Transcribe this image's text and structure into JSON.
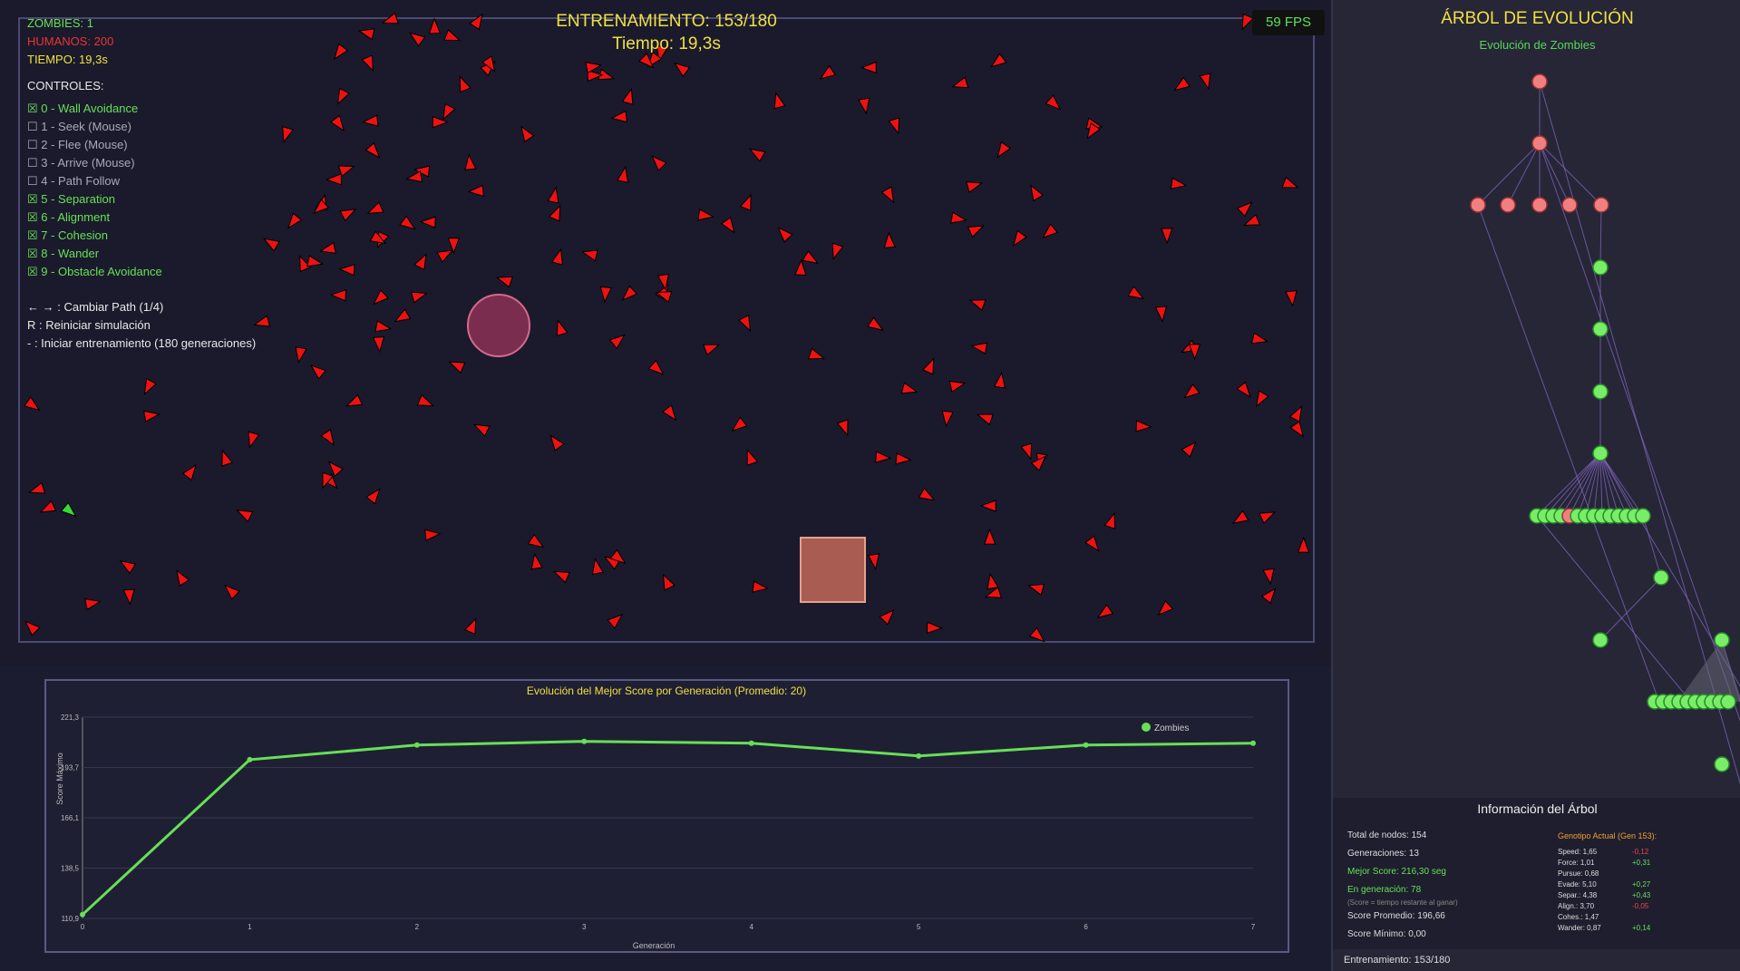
{
  "simulation": {
    "stats": {
      "zombies": "ZOMBIES: 1",
      "humans": "HUMANOS: 200",
      "time": "TIEMPO: 19,3s"
    },
    "controls_header": "CONTROLES:",
    "controls": [
      {
        "label": "☒ 0 - Wall Avoidance",
        "active": true
      },
      {
        "label": "☐ 1 - Seek (Mouse)",
        "active": false
      },
      {
        "label": "☐ 2 - Flee (Mouse)",
        "active": false
      },
      {
        "label": "☐ 3 - Arrive (Mouse)",
        "active": false
      },
      {
        "label": "☐ 4 - Path Follow",
        "active": false
      },
      {
        "label": "☒ 5 - Separation",
        "active": true
      },
      {
        "label": "☒ 6 - Alignment",
        "active": true
      },
      {
        "label": "☒ 7 - Cohesion",
        "active": true
      },
      {
        "label": "☒ 8 - Wander",
        "active": true
      },
      {
        "label": "☒ 9 - Obstacle Avoidance",
        "active": true
      }
    ],
    "hints": [
      "← → : Cambiar Path (1/4)",
      "R : Reiniciar simulación",
      "- : Iniciar entrenamiento (180 generaciones)"
    ],
    "title_line1": "ENTRENAMIENTO: 153/180",
    "title_line2": "Tiempo: 19,3s",
    "fps": "59 FPS",
    "colors": {
      "human": "#ee1111",
      "zombie": "#33dd33",
      "active": "#66e055",
      "humans_text": "#ee3333"
    }
  },
  "chart": {
    "title": "Evolución del Mejor Score por Generación (Promedio: 20)",
    "legend": "Zombies",
    "chart_data": {
      "type": "line",
      "title": "Evolución del Mejor Score por Generación (Promedio: 20)",
      "xlabel": "Generación",
      "ylabel": "Score Máximo",
      "x": [
        0,
        1,
        2,
        3,
        4,
        5,
        6,
        7
      ],
      "series": [
        {
          "name": "Zombies",
          "values": [
            113,
            198,
            206,
            208,
            207,
            200,
            206,
            207
          ],
          "color": "#66e055"
        }
      ],
      "y_ticks": [
        "221,3",
        "193,7",
        "166,1",
        "138,5",
        "110,9"
      ],
      "ylim": [
        110.9,
        221.3
      ],
      "grid": true,
      "legend_position": "top-right"
    }
  },
  "tree": {
    "title": "ÁRBOL DE EVOLUCIÓN",
    "subtitle": "Evolución de Zombies",
    "info": {
      "title": "Información del Árbol",
      "total_nodes": "Total de nodos: 154",
      "generations": "Generaciones: 13",
      "best_score": "Mejor Score: 216,30 seg",
      "in_generation": "En generación: 78",
      "note": "(Score = tiempo restante al ganar)",
      "avg_score": "Score Promedio: 196,66",
      "min_score": "Score Mínimo: 0,00",
      "genotype_title": "Genotipo Actual (Gen 153):",
      "genes": [
        {
          "label": "Speed: 1,65",
          "delta": "-0,12",
          "positive": false
        },
        {
          "label": "Force: 1,01",
          "delta": "+0,31",
          "positive": true
        },
        {
          "label": "Pursue: 0,68",
          "delta": "",
          "positive": true
        },
        {
          "label": "Evade: 5,10",
          "delta": "+0,27",
          "positive": true
        },
        {
          "label": "Separ.: 4,38",
          "delta": "+0,43",
          "positive": true
        },
        {
          "label": "Align.: 3,70",
          "delta": "-0,05",
          "positive": false
        },
        {
          "label": "Cohes.: 1,47",
          "delta": "",
          "positive": true
        },
        {
          "label": "Wander: 0,87",
          "delta": "+0,14",
          "positive": true
        }
      ]
    },
    "footer": "Entrenamiento: 153/180"
  }
}
